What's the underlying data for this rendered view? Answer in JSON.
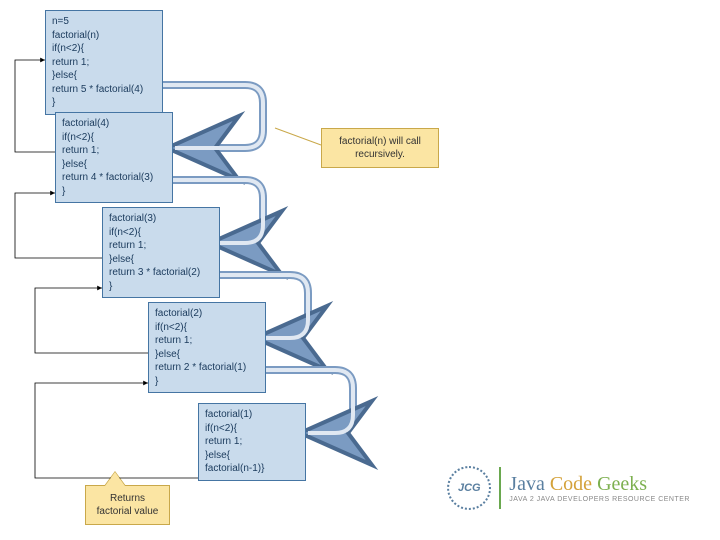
{
  "boxes": {
    "b1": "n=5\nfactorial(n)\nif(n<2){\nreturn 1;\n}else{\nreturn 5 * factorial(4)\n}",
    "b2": "factorial(4)\nif(n<2){\nreturn 1;\n}else{\nreturn 4 * factorial(3)\n}",
    "b3": "factorial(3)\nif(n<2){\nreturn 1;\n}else{\nreturn 3 * factorial(2)\n}",
    "b4": "factorial(2)\nif(n<2){\nreturn 1;\n}else{\nreturn 2 * factorial(1)\n}",
    "b5": "factorial(1)\nif(n<2){\nreturn 1;\n}else{\nfactorial(n-1)}"
  },
  "callouts": {
    "recursive": "factorial(n) will call\nrecursively.",
    "returns": "Returns\nfactorial value"
  },
  "logo": {
    "badge": "JCG",
    "w1": "Java",
    "w2": "Code",
    "w3": "Geeks",
    "sub": "JAVA 2 JAVA DEVELOPERS RESOURCE CENTER"
  }
}
